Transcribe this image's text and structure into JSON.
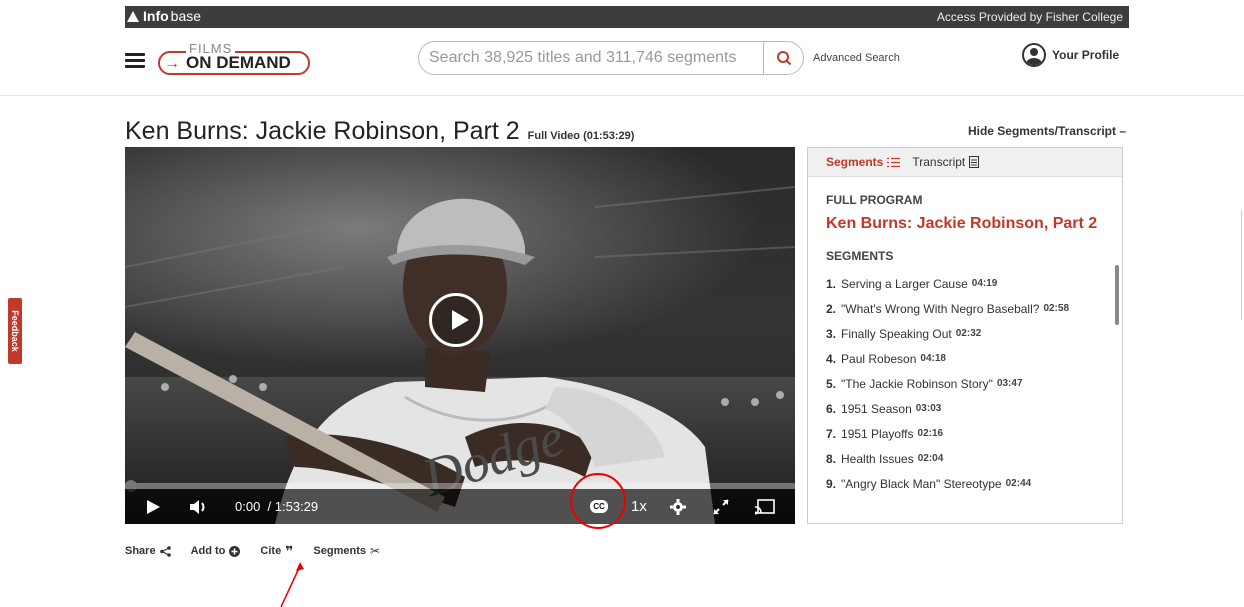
{
  "topbar": {
    "brand_bold": "Info",
    "brand_light": "base",
    "access": "Access Provided by Fisher College"
  },
  "header": {
    "logo_top": "FILMS",
    "logo_bottom": "ON DEMAND",
    "search_placeholder": "Search 38,925 titles and 311,746 segments",
    "advanced_search": "Advanced Search",
    "profile": "Your Profile"
  },
  "page": {
    "title": "Ken Burns: Jackie Robinson, Part 2",
    "subtitle": "Full Video (01:53:29)",
    "hide_toggle": "Hide Segments/Transcript –"
  },
  "feedback": "Feedback",
  "player": {
    "current_time": "0:00",
    "duration": "/ 1:53:29",
    "cc": "CC",
    "speed": "1x",
    "progress_fraction": 0
  },
  "panel": {
    "tab_segments": "Segments",
    "tab_transcript": "Transcript",
    "full_program_label": "FULL PROGRAM",
    "program_title": "Ken Burns: Jackie Robinson, Part 2",
    "segments_label": "SEGMENTS",
    "segments": [
      {
        "num": "1.",
        "title": "Serving a Larger Cause",
        "dur": "04:19"
      },
      {
        "num": "2.",
        "title": "\"What's Wrong With Negro Baseball?",
        "dur": "02:58"
      },
      {
        "num": "3.",
        "title": "Finally Speaking Out",
        "dur": "02:32"
      },
      {
        "num": "4.",
        "title": "Paul Robeson",
        "dur": "04:18"
      },
      {
        "num": "5.",
        "title": "\"The Jackie Robinson Story\"",
        "dur": "03:47"
      },
      {
        "num": "6.",
        "title": "1951 Season",
        "dur": "03:03"
      },
      {
        "num": "7.",
        "title": "1951 Playoffs",
        "dur": "02:16"
      },
      {
        "num": "8.",
        "title": "Health Issues",
        "dur": "02:04"
      },
      {
        "num": "9.",
        "title": "\"Angry Black Man\" Stereotype",
        "dur": "02:44"
      }
    ]
  },
  "actions": {
    "share": "Share",
    "add_to": "Add to",
    "cite": "Cite",
    "segments": "Segments"
  },
  "colors": {
    "accent_red": "#c0392b",
    "dark_bar": "#3d3d3d"
  }
}
